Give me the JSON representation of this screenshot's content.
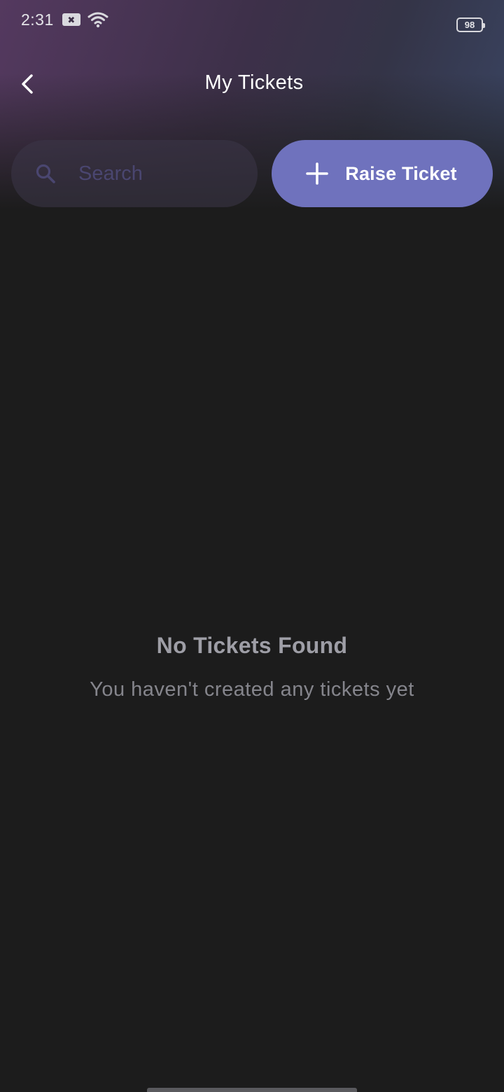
{
  "status_bar": {
    "time": "2:31",
    "notification_glyph": "✖",
    "battery": "98"
  },
  "app_bar": {
    "title": "My Tickets",
    "back_icon": "chevron-left-icon"
  },
  "search": {
    "placeholder": "Search",
    "value": "",
    "icon": "search-icon"
  },
  "raise_button": {
    "label": "Raise Ticket",
    "icon": "plus-icon"
  },
  "empty_state": {
    "title": "No Tickets Found",
    "subtitle": "You haven't created any tickets yet"
  },
  "colors": {
    "background": "#1c1c1c",
    "accent": "#6f72bd",
    "header_purple": "#54395f",
    "header_blue": "#3a4563",
    "placeholder": "#4a4670",
    "empty_title": "#9e9ea6",
    "empty_subtitle": "#85858c"
  }
}
